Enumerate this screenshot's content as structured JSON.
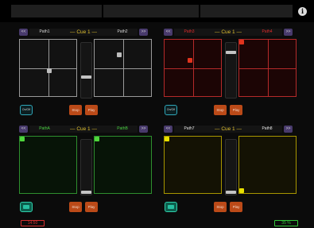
{
  "topbar": {
    "info_label": "i"
  },
  "panels": [
    {
      "prev_label": "<<",
      "next_label": ">>",
      "path_left": "Path1",
      "path_right": "Path2",
      "cue": "— Cue 1 —",
      "onoff_label": "On/Off",
      "stop_label": "Stop",
      "play_label": "Play",
      "accent": "#9a9a9a",
      "pad_bg": "#121212",
      "path_color": "#d6d6d6",
      "cue_color": "#e0c030",
      "pad_left_handle": [
        0.52,
        0.55
      ],
      "pad_right_handle": [
        0.44,
        0.27
      ],
      "fader_level": 0.37
    },
    {
      "prev_label": "<<",
      "next_label": ">>",
      "path_left": "Path3",
      "path_right": "Path4",
      "cue": "— Cue 1 —",
      "onoff_label": "On/Off",
      "stop_label": "Stop",
      "play_label": "Play",
      "accent": "#b52a2a",
      "pad_bg": "#1c0505",
      "path_color": "#e02b2b",
      "cue_color": "#e0c030",
      "pad_left_handle": [
        0.45,
        0.36
      ],
      "pad_right_handle": [
        0.04,
        0.04
      ],
      "fader_level": 0.84
    },
    {
      "prev_label": "<<",
      "next_label": ">>",
      "path_left": "PathA",
      "path_right": "PathB",
      "cue": "— Cue 1 —",
      "onoff_label": "",
      "stop_label": "Stop",
      "play_label": "Play",
      "accent": "#2e8f2e",
      "pad_bg": "#071407",
      "path_color": "#48d040",
      "cue_color": "#e0c030",
      "pad_left_handle": [
        0.04,
        0.04
      ],
      "pad_right_handle": [
        0.04,
        0.04
      ],
      "fader_level": 0.02
    },
    {
      "prev_label": "<<",
      "next_label": ">>",
      "path_left": "Path7",
      "path_right": "Path8",
      "cue": "— Cue 1 —",
      "onoff_label": "",
      "stop_label": "Stop",
      "play_label": "Play",
      "accent": "#a89600",
      "pad_bg": "#141204",
      "path_color": "#e6e6e6",
      "cue_color": "#e0c030",
      "pad_left_handle": [
        0.04,
        0.04
      ],
      "pad_right_handle": [
        0.04,
        0.96
      ],
      "fader_level": 0.02
    }
  ],
  "status": {
    "time": "14:50",
    "percent": "35 %"
  },
  "colors": {
    "time": "#d83030",
    "percent": "#34c83c",
    "stop_play_fill": "#bb4a18",
    "arrow_fill": "#483a6c"
  }
}
